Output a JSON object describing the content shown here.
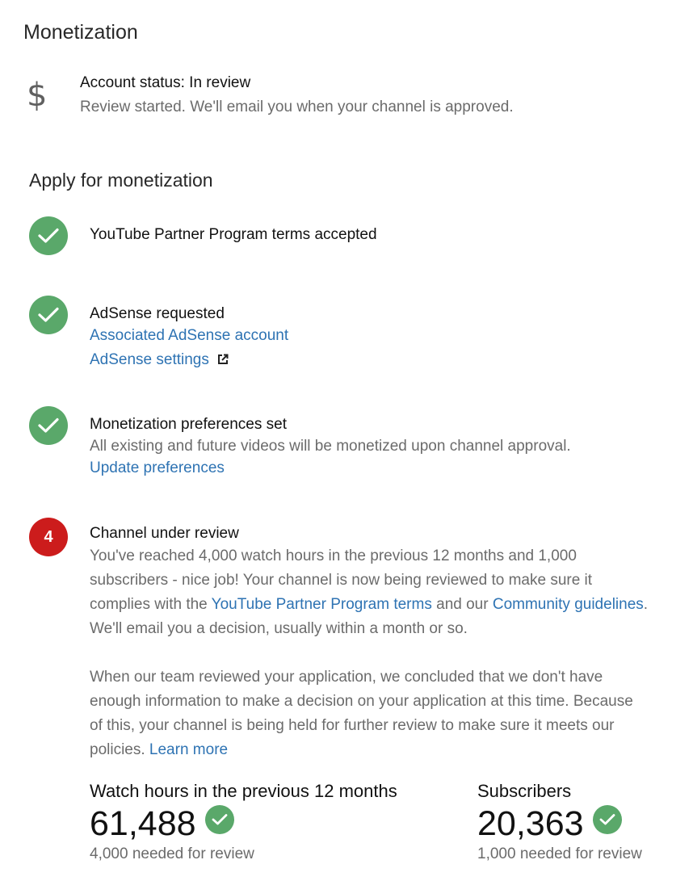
{
  "page": {
    "title": "Monetization"
  },
  "account": {
    "icon": "dollar-icon",
    "status_title": "Account status: In review",
    "status_sub": "Review started. We'll email you when your channel is approved."
  },
  "apply": {
    "section_title": "Apply for monetization",
    "steps": [
      {
        "state": "done",
        "icon": "checkmark-icon",
        "title": "YouTube Partner Program terms accepted"
      },
      {
        "state": "done",
        "icon": "checkmark-icon",
        "title": "AdSense requested",
        "link1": "Associated AdSense account",
        "link2": "AdSense settings",
        "link2_icon": "external-link-icon"
      },
      {
        "state": "done",
        "icon": "checkmark-icon",
        "title": "Monetization preferences set",
        "sub": "All existing and future videos will be monetized upon channel approval.",
        "link1": "Update preferences"
      },
      {
        "state": "current",
        "number": "4",
        "title": "Channel under review",
        "para1": {
          "line1": "You've reached 4,000 watch hours in the previous 12 months and 1,000",
          "line2": "subscribers - nice job! Your channel is now being reviewed to make sure it",
          "line3_pre": "complies with the ",
          "line3_link1": "YouTube Partner Program terms",
          "line3_mid": " and our ",
          "line3_link2": "Community guidelines",
          "line3_post": ".",
          "line4": "We'll email you a decision, usually within a month or so."
        },
        "para2": {
          "line1": "When our team reviewed your application, we concluded that we don't have",
          "line2": "enough information to make a decision on your application at this time. Because",
          "line3": "of this, your channel is being held for further review to make sure it meets our",
          "line4_pre": "policies. ",
          "line4_link": "Learn more"
        }
      }
    ]
  },
  "metrics": {
    "watch_hours": {
      "label": "Watch hours in the previous 12 months",
      "value": "61,488",
      "note": "4,000 needed for review"
    },
    "subscribers": {
      "label": "Subscribers",
      "value": "20,363",
      "note": "1,000 needed for review"
    }
  },
  "colors": {
    "check_green": "#5aa86a",
    "step_red": "#cc1c1c",
    "link_blue": "#2e73b3"
  }
}
